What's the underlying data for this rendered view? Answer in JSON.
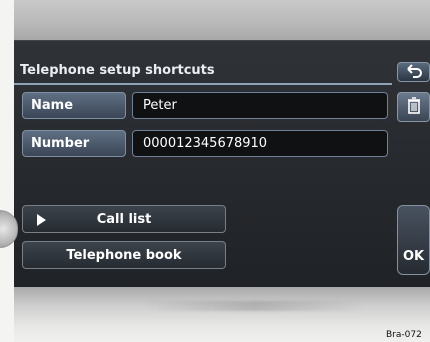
{
  "header": {
    "title": "Telephone setup shortcuts"
  },
  "fields": {
    "name_label": "Name",
    "name_value": "Peter",
    "number_label": "Number",
    "number_value": "000012345678910"
  },
  "buttons": {
    "call_list": "Call list",
    "telephone_book": "Telephone book",
    "ok": "OK"
  },
  "icons": {
    "back": "back-icon",
    "delete": "trash-icon",
    "call_list": "play-icon"
  },
  "footer": {
    "reference": "Bra-072"
  }
}
